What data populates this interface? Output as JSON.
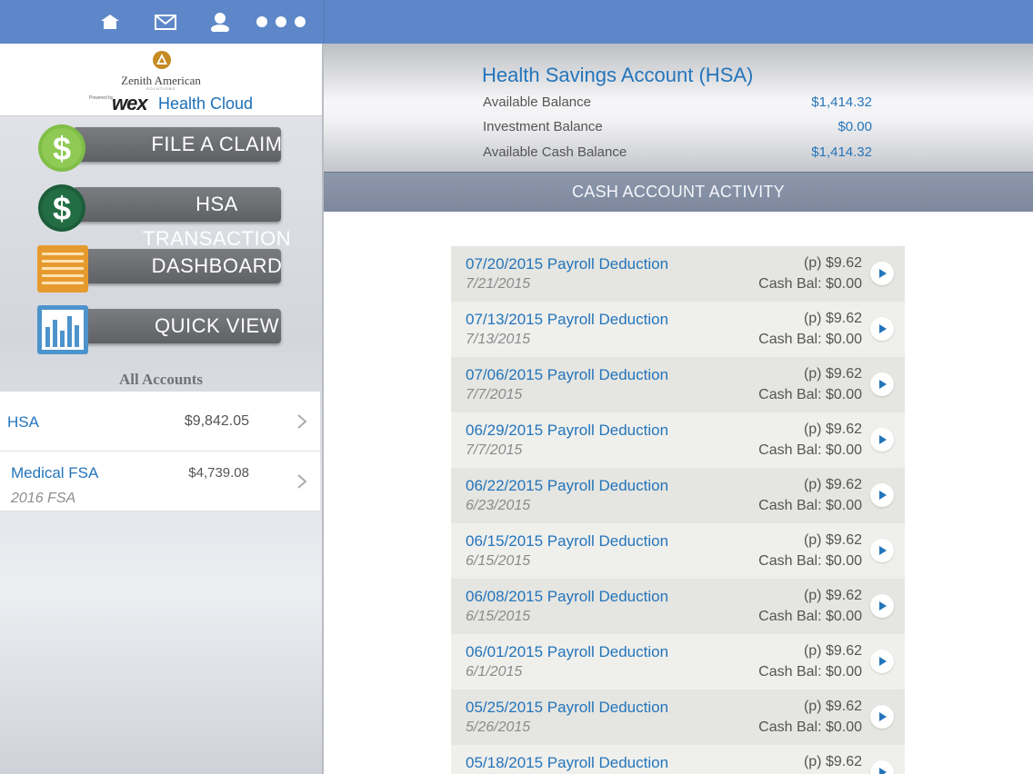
{
  "toolbar": {
    "icons": [
      "home-icon",
      "mail-icon",
      "profile-icon",
      "more-icon"
    ]
  },
  "brand": {
    "name": "Zenith American",
    "sub": "SOLUTIONS",
    "powered": "Powered by",
    "wex": "wex",
    "cloud": "Health Cloud"
  },
  "menu": [
    {
      "label": "FILE A CLAIM",
      "icon": "dollar-icon"
    },
    {
      "label": "HSA TRANSACTION",
      "icon": "dollar-icon"
    },
    {
      "label": "DASHBOARD",
      "icon": "dashboard-icon"
    },
    {
      "label": "QUICK VIEW",
      "icon": "bar-chart-icon"
    }
  ],
  "accounts": {
    "heading": "All Accounts",
    "items": [
      {
        "name": "HSA",
        "amount": "$9,842.05",
        "sub": ""
      },
      {
        "name": "Medical FSA",
        "amount": "$4,739.08",
        "sub": "2016 FSA"
      }
    ]
  },
  "hsa": {
    "title": "Health Savings Account (HSA)",
    "balances": [
      {
        "label": "Available Balance",
        "value": "$1,414.32"
      },
      {
        "label": "Investment Balance",
        "value": "$0.00"
      },
      {
        "label": "Available Cash Balance",
        "value": "$1,414.32"
      }
    ]
  },
  "activity": {
    "heading": "CASH ACCOUNT ACTIVITY",
    "rows": [
      {
        "desc": "07/20/2015 Payroll Deduction",
        "date": "7/21/2015",
        "amount": "(p) $9.62",
        "cash_bal": "Cash Bal: $0.00"
      },
      {
        "desc": "07/13/2015 Payroll Deduction",
        "date": "7/13/2015",
        "amount": "(p) $9.62",
        "cash_bal": "Cash Bal: $0.00"
      },
      {
        "desc": "07/06/2015 Payroll Deduction",
        "date": "7/7/2015",
        "amount": "(p) $9.62",
        "cash_bal": "Cash Bal: $0.00"
      },
      {
        "desc": "06/29/2015 Payroll Deduction",
        "date": "7/7/2015",
        "amount": "(p) $9.62",
        "cash_bal": "Cash Bal: $0.00"
      },
      {
        "desc": "06/22/2015 Payroll Deduction",
        "date": "6/23/2015",
        "amount": "(p) $9.62",
        "cash_bal": "Cash Bal: $0.00"
      },
      {
        "desc": "06/15/2015 Payroll Deduction",
        "date": "6/15/2015",
        "amount": "(p) $9.62",
        "cash_bal": "Cash Bal: $0.00"
      },
      {
        "desc": "06/08/2015 Payroll Deduction",
        "date": "6/15/2015",
        "amount": "(p) $9.62",
        "cash_bal": "Cash Bal: $0.00"
      },
      {
        "desc": "06/01/2015 Payroll Deduction",
        "date": "6/1/2015",
        "amount": "(p) $9.62",
        "cash_bal": "Cash Bal: $0.00"
      },
      {
        "desc": "05/25/2015 Payroll Deduction",
        "date": "5/26/2015",
        "amount": "(p) $9.62",
        "cash_bal": "Cash Bal: $0.00"
      },
      {
        "desc": "05/18/2015 Payroll Deduction",
        "date": "",
        "amount": "(p) $9.62",
        "cash_bal": ""
      }
    ]
  },
  "colors": {
    "topbar": "#5d87c9",
    "link_blue": "#2475bb",
    "section_bar": "#8590a5"
  }
}
